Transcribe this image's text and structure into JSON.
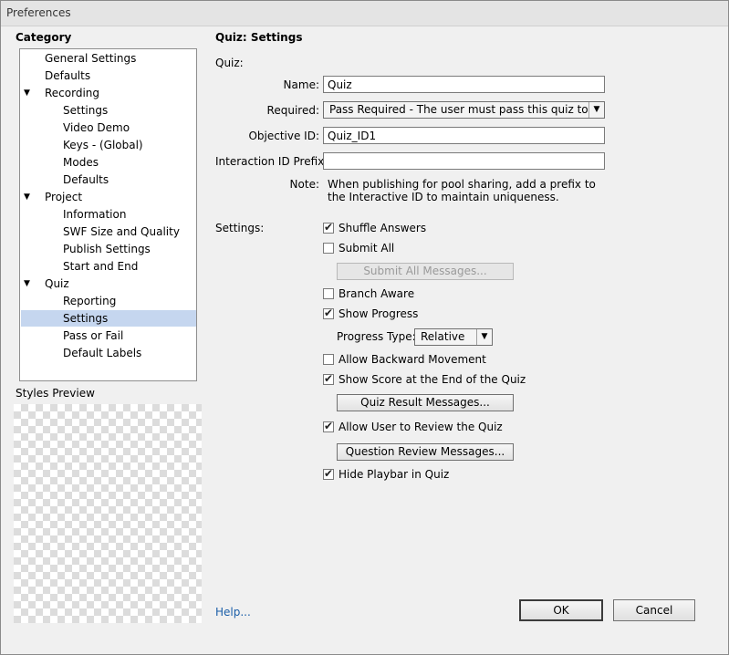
{
  "window": {
    "title": "Preferences"
  },
  "category": {
    "heading": "Category",
    "items": [
      {
        "label": "General Settings",
        "level": 0,
        "expander": false,
        "selected": false
      },
      {
        "label": "Defaults",
        "level": 0,
        "expander": false,
        "selected": false
      },
      {
        "label": "Recording",
        "level": 0,
        "expander": true,
        "selected": false
      },
      {
        "label": "Settings",
        "level": 1,
        "expander": false,
        "selected": false
      },
      {
        "label": "Video Demo",
        "level": 1,
        "expander": false,
        "selected": false
      },
      {
        "label": "Keys - (Global)",
        "level": 1,
        "expander": false,
        "selected": false
      },
      {
        "label": "Modes",
        "level": 1,
        "expander": false,
        "selected": false
      },
      {
        "label": "Defaults",
        "level": 1,
        "expander": false,
        "selected": false
      },
      {
        "label": "Project",
        "level": 0,
        "expander": true,
        "selected": false
      },
      {
        "label": "Information",
        "level": 1,
        "expander": false,
        "selected": false
      },
      {
        "label": "SWF Size and Quality",
        "level": 1,
        "expander": false,
        "selected": false
      },
      {
        "label": "Publish Settings",
        "level": 1,
        "expander": false,
        "selected": false
      },
      {
        "label": "Start and End",
        "level": 1,
        "expander": false,
        "selected": false
      },
      {
        "label": "Quiz",
        "level": 0,
        "expander": true,
        "selected": false
      },
      {
        "label": "Reporting",
        "level": 1,
        "expander": false,
        "selected": false
      },
      {
        "label": "Settings",
        "level": 1,
        "expander": false,
        "selected": true
      },
      {
        "label": "Pass or Fail",
        "level": 1,
        "expander": false,
        "selected": false
      },
      {
        "label": "Default Labels",
        "level": 1,
        "expander": false,
        "selected": false
      }
    ]
  },
  "styles_preview": {
    "label": "Styles Preview"
  },
  "panel": {
    "heading": "Quiz: Settings",
    "quiz_label": "Quiz:",
    "name_label": "Name:",
    "name_value": "Quiz",
    "required_label": "Required:",
    "required_value": "Pass Required - The user must pass this quiz to ...",
    "objective_label": "Objective ID:",
    "objective_value": "Quiz_ID1",
    "prefix_label": "Interaction ID Prefix:",
    "prefix_value": "",
    "note_label": "Note:",
    "note_line1": "When publishing for pool sharing, add a prefix to",
    "note_line2": "the Interactive ID to maintain uniqueness.",
    "settings_label": "Settings:",
    "shuffle": "Shuffle Answers",
    "submit_all": "Submit All",
    "submit_all_messages": "Submit All Messages...",
    "branch_aware": "Branch Aware",
    "show_progress": "Show Progress",
    "progress_type_label": "Progress Type:",
    "progress_type_value": "Relative",
    "allow_backward": "Allow Backward Movement",
    "show_score": "Show Score at the End of the Quiz",
    "quiz_result_messages": "Quiz Result Messages...",
    "allow_review": "Allow User to Review the Quiz",
    "question_review_messages": "Question Review Messages...",
    "hide_playbar": "Hide Playbar in Quiz"
  },
  "footer": {
    "help": "Help...",
    "ok": "OK",
    "cancel": "Cancel"
  }
}
